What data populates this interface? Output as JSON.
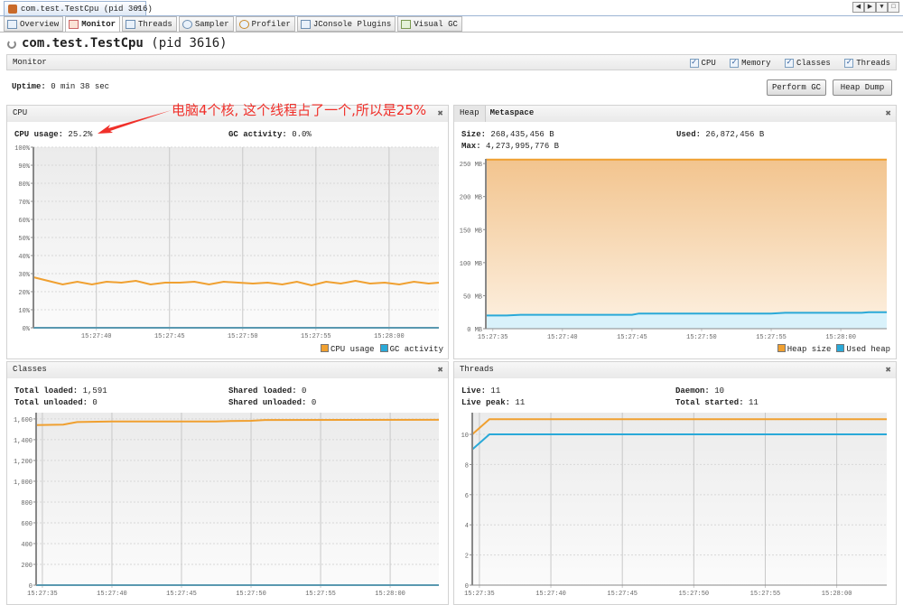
{
  "window": {
    "doc_tab": "com.test.TestCpu (pid 3616)",
    "controls": [
      "◀",
      "▶",
      "▼",
      "□"
    ]
  },
  "tabs": [
    {
      "label": "Overview"
    },
    {
      "label": "Monitor"
    },
    {
      "label": "Threads"
    },
    {
      "label": "Sampler"
    },
    {
      "label": "Profiler"
    },
    {
      "label": "JConsole Plugins"
    },
    {
      "label": "Visual GC"
    }
  ],
  "header": {
    "app": "com.test.TestCpu",
    "pid": "(pid 3616)"
  },
  "monitor": {
    "label": "Monitor",
    "checks": [
      "CPU",
      "Memory",
      "Classes",
      "Threads"
    ],
    "uptime_label": "Uptime:",
    "uptime": "0 min 38 sec",
    "perform_gc": "Perform GC",
    "heap_dump": "Heap Dump"
  },
  "annotation": "电脑4个核, 这个线程占了一个,所以是25%",
  "cpu": {
    "title": "CPU",
    "usage_label": "CPU usage:",
    "usage": "25.2%",
    "gc_label": "GC activity:",
    "gc": "0.0%"
  },
  "memory": {
    "tab_heap": "Heap",
    "tab_meta": "Metaspace",
    "size_label": "Size:",
    "size": "268,435,456 B",
    "used_label": "Used:",
    "used": "26,872,456 B",
    "max_label": "Max:",
    "max": "4,273,995,776 B"
  },
  "classes": {
    "title": "Classes",
    "total_loaded_label": "Total loaded:",
    "total_loaded": "1,591",
    "total_unloaded_label": "Total unloaded:",
    "total_unloaded": "0",
    "shared_loaded_label": "Shared loaded:",
    "shared_loaded": "0",
    "shared_unloaded_label": "Shared unloaded:",
    "shared_unloaded": "0"
  },
  "threads": {
    "title": "Threads",
    "live_label": "Live:",
    "live": "11",
    "peak_label": "Live peak:",
    "peak": "11",
    "daemon_label": "Daemon:",
    "daemon": "10",
    "started_label": "Total started:",
    "started": "11"
  },
  "chart_data": [
    {
      "type": "line",
      "title": "CPU",
      "xlim": [
        0.7,
        28.4
      ],
      "ylim": [
        0,
        100
      ],
      "xticks": [
        {
          "v": 5,
          "label": "15:27:40"
        },
        {
          "v": 10,
          "label": "15:27:45"
        },
        {
          "v": 15,
          "label": "15:27:50"
        },
        {
          "v": 20,
          "label": "15:27:55"
        },
        {
          "v": 25,
          "label": "15:28:00"
        }
      ],
      "yticks": [
        {
          "v": 0,
          "label": "0%"
        },
        {
          "v": 10,
          "label": "10%"
        },
        {
          "v": 20,
          "label": "20%"
        },
        {
          "v": 30,
          "label": "30%"
        },
        {
          "v": 40,
          "label": "40%"
        },
        {
          "v": 50,
          "label": "50%"
        },
        {
          "v": 60,
          "label": "60%"
        },
        {
          "v": 70,
          "label": "70%"
        },
        {
          "v": 80,
          "label": "80%"
        },
        {
          "v": 90,
          "label": "90%"
        },
        {
          "v": 100,
          "label": "100%"
        }
      ],
      "legend": "bottom-right",
      "series": [
        {
          "name": "CPU usage",
          "color": "#f0a030",
          "x": [
            0.7,
            1.7,
            2.7,
            3.7,
            4.7,
            5.7,
            6.7,
            7.7,
            8.7,
            9.7,
            10.7,
            11.7,
            12.7,
            13.7,
            14.7,
            15.7,
            16.7,
            17.7,
            18.7,
            19.7,
            20.7,
            21.7,
            22.7,
            23.7,
            24.7,
            25.7,
            26.7,
            27.7,
            28.4
          ],
          "y": [
            28,
            26,
            24,
            25.5,
            24,
            25.5,
            25,
            26,
            24,
            25,
            25,
            25.5,
            24,
            25.5,
            25,
            24.5,
            25,
            24,
            25.5,
            23.5,
            25.5,
            24.5,
            26,
            24.5,
            25,
            24,
            25.5,
            24.5,
            25
          ]
        },
        {
          "name": "GC activity",
          "color": "#2aa9d8",
          "x": [
            0.7,
            28.4
          ],
          "y": [
            0,
            0
          ]
        }
      ]
    },
    {
      "type": "area",
      "title": "Heap",
      "xlim": [
        -0.5,
        28.3
      ],
      "ylim": [
        0,
        257
      ],
      "xticks": [
        {
          "v": 0,
          "label": "15:27:35"
        },
        {
          "v": 5,
          "label": "15:27:40"
        },
        {
          "v": 10,
          "label": "15:27:45"
        },
        {
          "v": 15,
          "label": "15:27:50"
        },
        {
          "v": 20,
          "label": "15:27:55"
        },
        {
          "v": 25,
          "label": "15:28:00"
        }
      ],
      "yticks": [
        {
          "v": 0,
          "label": "0 MB"
        },
        {
          "v": 50,
          "label": "50 MB"
        },
        {
          "v": 100,
          "label": "100 MB"
        },
        {
          "v": 150,
          "label": "150 MB"
        },
        {
          "v": 200,
          "label": "200 MB"
        },
        {
          "v": 250,
          "label": "250 MB"
        }
      ],
      "legend": "bottom-right",
      "series": [
        {
          "name": "Heap size",
          "color": "#f0a030",
          "fill": "heap",
          "x": [
            -0.5,
            28.3
          ],
          "y": [
            256,
            256
          ]
        },
        {
          "name": "Used heap",
          "color": "#2aa9d8",
          "fill": "#d9f2fb",
          "x": [
            -0.5,
            1,
            2,
            10,
            10.5,
            20,
            21,
            26.5,
            27,
            28.3
          ],
          "y": [
            20,
            20,
            21,
            21,
            23,
            23,
            24,
            24,
            25,
            25
          ]
        }
      ]
    },
    {
      "type": "line",
      "title": "Classes",
      "xlim": [
        -0.45,
        28.5
      ],
      "ylim": [
        0,
        1660
      ],
      "xticks": [
        {
          "v": 0,
          "label": "15:27:35"
        },
        {
          "v": 5,
          "label": "15:27:40"
        },
        {
          "v": 10,
          "label": "15:27:45"
        },
        {
          "v": 15,
          "label": "15:27:50"
        },
        {
          "v": 20,
          "label": "15:27:55"
        },
        {
          "v": 25,
          "label": "15:28:00"
        }
      ],
      "yticks": [
        {
          "v": 0,
          "label": "0"
        },
        {
          "v": 200,
          "label": "200"
        },
        {
          "v": 400,
          "label": "400"
        },
        {
          "v": 600,
          "label": "600"
        },
        {
          "v": 800,
          "label": "800"
        },
        {
          "v": 1000,
          "label": "1,000"
        },
        {
          "v": 1200,
          "label": "1,200"
        },
        {
          "v": 1400,
          "label": "1,400"
        },
        {
          "v": 1600,
          "label": "1,600"
        }
      ],
      "series": [
        {
          "name": "Total loaded",
          "color": "#f0a030",
          "x": [
            -0.45,
            1.5,
            2.5,
            5,
            12.5,
            13.5,
            15,
            16,
            28.5
          ],
          "y": [
            1540,
            1545,
            1570,
            1575,
            1575,
            1580,
            1582,
            1590,
            1591
          ]
        },
        {
          "name": "Shared loaded",
          "color": "#2aa9d8",
          "x": [
            -0.45,
            28.5
          ],
          "y": [
            0,
            0
          ]
        }
      ]
    },
    {
      "type": "line",
      "title": "Threads",
      "xlim": [
        -0.5,
        28.5
      ],
      "ylim": [
        0,
        11.44
      ],
      "xticks": [
        {
          "v": 0,
          "label": "15:27:35"
        },
        {
          "v": 5,
          "label": "15:27:40"
        },
        {
          "v": 10,
          "label": "15:27:45"
        },
        {
          "v": 15,
          "label": "15:27:50"
        },
        {
          "v": 20,
          "label": "15:27:55"
        },
        {
          "v": 25,
          "label": "15:28:00"
        }
      ],
      "yticks": [
        {
          "v": 0,
          "label": "0"
        },
        {
          "v": 2,
          "label": "2"
        },
        {
          "v": 4,
          "label": "4"
        },
        {
          "v": 6,
          "label": "6"
        },
        {
          "v": 8,
          "label": "8"
        },
        {
          "v": 10,
          "label": "10"
        }
      ],
      "series": [
        {
          "name": "Live threads",
          "color": "#f0a030",
          "x": [
            -0.5,
            0.7,
            28.5
          ],
          "y": [
            10,
            11,
            11
          ]
        },
        {
          "name": "Daemon threads",
          "color": "#2aa9d8",
          "x": [
            -0.5,
            0.7,
            28.5
          ],
          "y": [
            9,
            10,
            10
          ]
        }
      ]
    }
  ]
}
